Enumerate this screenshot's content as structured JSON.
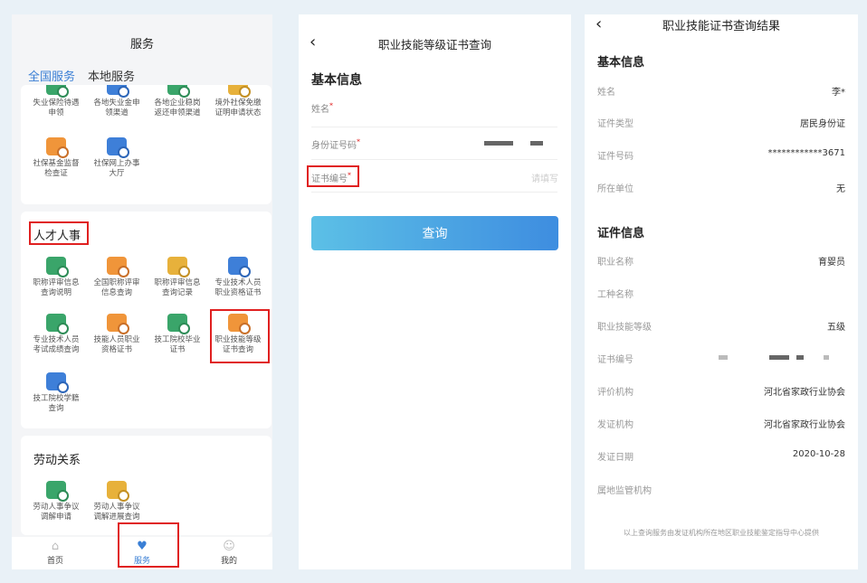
{
  "panel1": {
    "title": "服务",
    "tabs": [
      {
        "label": "全国服务",
        "active": true
      },
      {
        "label": "本地服务",
        "active": false
      }
    ],
    "card1_items": [
      {
        "l1": "失业保险待遇",
        "l2": "申领",
        "icon": "green"
      },
      {
        "l1": "各地失业金申",
        "l2": "领渠道",
        "icon": "blue"
      },
      {
        "l1": "各地企业稳岗",
        "l2": "返还申领渠道",
        "icon": "green"
      },
      {
        "l1": "境外社保免缴",
        "l2": "证明申请状态",
        "icon": "gold"
      },
      {
        "l1": "社保基金监督",
        "l2": "检查证",
        "icon": "orange"
      },
      {
        "l1": "社保网上办事",
        "l2": "大厅",
        "icon": "blue"
      }
    ],
    "section_talent": "人才人事",
    "card2_items": [
      {
        "l1": "职称评审信息",
        "l2": "查询说明",
        "icon": "green"
      },
      {
        "l1": "全国职称评审",
        "l2": "信息查询",
        "icon": "orange"
      },
      {
        "l1": "职称评审信息",
        "l2": "查询记录",
        "icon": "gold"
      },
      {
        "l1": "专业技术人员",
        "l2": "职业资格证书",
        "icon": "blue"
      },
      {
        "l1": "专业技术人员",
        "l2": "考试成绩查询",
        "icon": "green"
      },
      {
        "l1": "技能人员职业",
        "l2": "资格证书",
        "icon": "orange"
      },
      {
        "l1": "技工院校毕业",
        "l2": "证书",
        "icon": "green"
      },
      {
        "l1": "职业技能等级",
        "l2": "证书查询",
        "icon": "orange"
      },
      {
        "l1": "技工院校学籍",
        "l2": "查询",
        "icon": "blue"
      }
    ],
    "section_labor": "劳动关系",
    "card3_items": [
      {
        "l1": "劳动人事争议",
        "l2": "调解申请",
        "icon": "green"
      },
      {
        "l1": "劳动人事争议",
        "l2": "调解进展查询",
        "icon": "gold"
      }
    ],
    "nav": [
      {
        "label": "首页",
        "icon": "home-icon",
        "active": false
      },
      {
        "label": "服务",
        "icon": "heart-icon",
        "active": true
      },
      {
        "label": "我的",
        "icon": "user-icon",
        "active": false
      }
    ]
  },
  "panel2": {
    "back": "‹",
    "title": "职业技能等级证书查询",
    "section": "基本信息",
    "name_label": "姓名",
    "id_label": "身份证号码",
    "cert_label": "证书编号",
    "required_mark": "*",
    "cert_placeholder": "请填写",
    "query_button": "查询"
  },
  "panel3": {
    "back": "‹",
    "title": "职业技能证书查询结果",
    "basic_section": "基本信息",
    "basic_rows": [
      {
        "k": "姓名",
        "v": "李*"
      },
      {
        "k": "证件类型",
        "v": "居民身份证"
      },
      {
        "k": "证件号码",
        "v": "************3671"
      },
      {
        "k": "所在单位",
        "v": "无"
      }
    ],
    "cert_section": "证件信息",
    "cert_rows": [
      {
        "k": "职业名称",
        "v": "育婴员"
      },
      {
        "k": "工种名称",
        "v": ""
      },
      {
        "k": "职业技能等级",
        "v": "五级"
      },
      {
        "k": "证书编号",
        "v": ""
      },
      {
        "k": "评价机构",
        "v": "河北省家政行业协会"
      },
      {
        "k": "发证机构",
        "v": "河北省家政行业协会"
      },
      {
        "k": "发证日期",
        "v": "2020-10-28"
      },
      {
        "k": "属地监管机构",
        "v": ""
      }
    ],
    "footer": "以上查询服务由发证机构所在地区职业技能鉴定指导中心提供"
  },
  "colors": {
    "accent": "#3a7fd5",
    "highlight": "#e02020",
    "background": "#e9f1f7"
  }
}
